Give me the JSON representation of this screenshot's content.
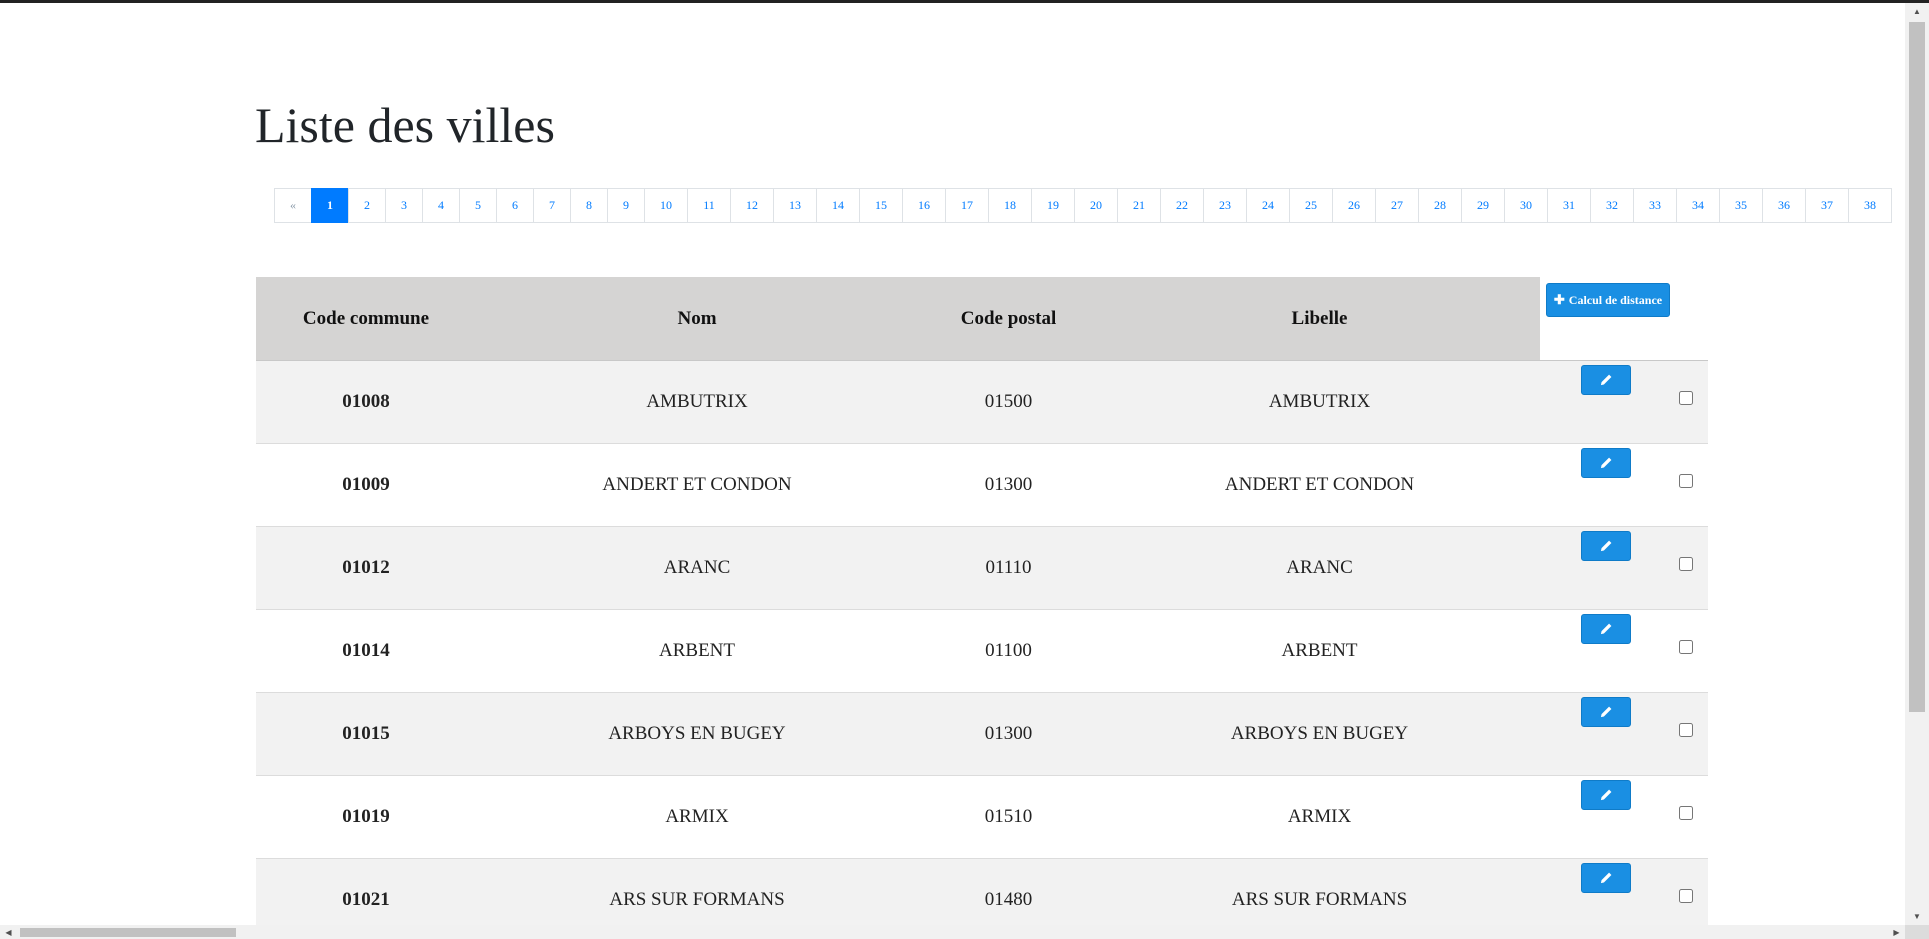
{
  "title": "Liste des villes",
  "pagination": {
    "prev_label": "«",
    "active_page": "1",
    "pages": [
      "1",
      "2",
      "3",
      "4",
      "5",
      "6",
      "7",
      "8",
      "9",
      "10",
      "11",
      "12",
      "13",
      "14",
      "15",
      "16",
      "17",
      "18",
      "19",
      "20",
      "21",
      "22",
      "23",
      "24",
      "25",
      "26",
      "27",
      "28",
      "29",
      "30",
      "31",
      "32",
      "33",
      "34",
      "35",
      "36",
      "37",
      "38"
    ]
  },
  "table": {
    "headers": {
      "code": "Code commune",
      "nom": "Nom",
      "postal": "Code postal",
      "libelle": "Libelle"
    },
    "calc_button_label": "Calcul de distance",
    "rows": [
      {
        "code": "01008",
        "nom": "AMBUTRIX",
        "postal": "01500",
        "libelle": "AMBUTRIX"
      },
      {
        "code": "01009",
        "nom": "ANDERT ET CONDON",
        "postal": "01300",
        "libelle": "ANDERT ET CONDON"
      },
      {
        "code": "01012",
        "nom": "ARANC",
        "postal": "01110",
        "libelle": "ARANC"
      },
      {
        "code": "01014",
        "nom": "ARBENT",
        "postal": "01100",
        "libelle": "ARBENT"
      },
      {
        "code": "01015",
        "nom": "ARBOYS EN BUGEY",
        "postal": "01300",
        "libelle": "ARBOYS EN BUGEY"
      },
      {
        "code": "01019",
        "nom": "ARMIX",
        "postal": "01510",
        "libelle": "ARMIX"
      },
      {
        "code": "01021",
        "nom": "ARS SUR FORMANS",
        "postal": "01480",
        "libelle": "ARS SUR FORMANS"
      }
    ]
  },
  "icons": {
    "edit": "pencil-icon",
    "calc": "plus-icon"
  },
  "colors": {
    "accent": "#1a8fe3",
    "pagination_active": "#007bff",
    "header_bg": "#d5d4d3",
    "row_odd_bg": "#f2f2f2"
  }
}
